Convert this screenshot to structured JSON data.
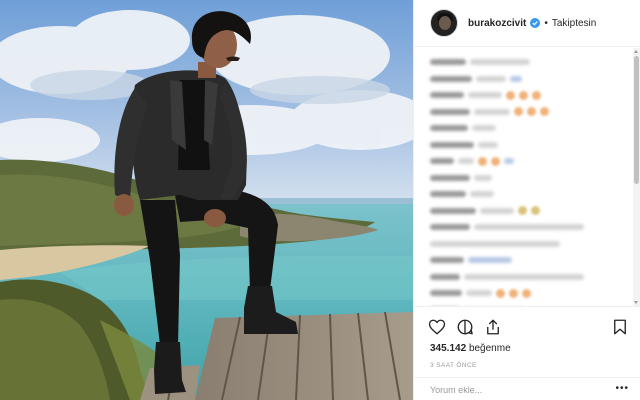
{
  "post": {
    "image_alt": "",
    "author": {
      "username": "burakozcivit",
      "verified": true,
      "follow_state": "Takiptesin",
      "separator": "•"
    },
    "comments_blurred": true,
    "likes": {
      "count": "345.142",
      "label": "beğenme"
    },
    "time_ago": "3 SAAT ÖNCE",
    "add_comment": {
      "placeholder": "Yorum ekle..."
    },
    "more_label": "•••"
  },
  "icons": {
    "like": "heart-icon",
    "comment": "comment-icon",
    "share": "share-icon",
    "save": "bookmark-icon",
    "verified": "verified-badge-icon",
    "more": "more-dots-icon"
  },
  "colors": {
    "text": "#262626",
    "muted": "#999999",
    "border": "#efefef",
    "verified_blue": "#3897f0",
    "sea": "#5fb4bd",
    "sky": "#7fa6d6"
  }
}
